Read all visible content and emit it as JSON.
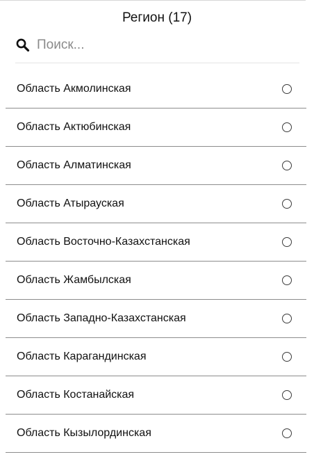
{
  "header": {
    "title": "Регион (17)"
  },
  "search": {
    "placeholder": "Поиск...",
    "value": "",
    "icon": "search-icon"
  },
  "regions": [
    {
      "label": "Область Акмолинская",
      "selected": false
    },
    {
      "label": "Область Актюбинская",
      "selected": false
    },
    {
      "label": "Область Алматинская",
      "selected": false
    },
    {
      "label": "Область Атырауская",
      "selected": false
    },
    {
      "label": "Область Восточно-Казахстанская",
      "selected": false
    },
    {
      "label": "Область Жамбылская",
      "selected": false
    },
    {
      "label": "Область Западно-Казахстанская",
      "selected": false
    },
    {
      "label": "Область Карагандинская",
      "selected": false
    },
    {
      "label": "Область Костанайская",
      "selected": false
    },
    {
      "label": "Область Кызылординская",
      "selected": false
    }
  ]
}
